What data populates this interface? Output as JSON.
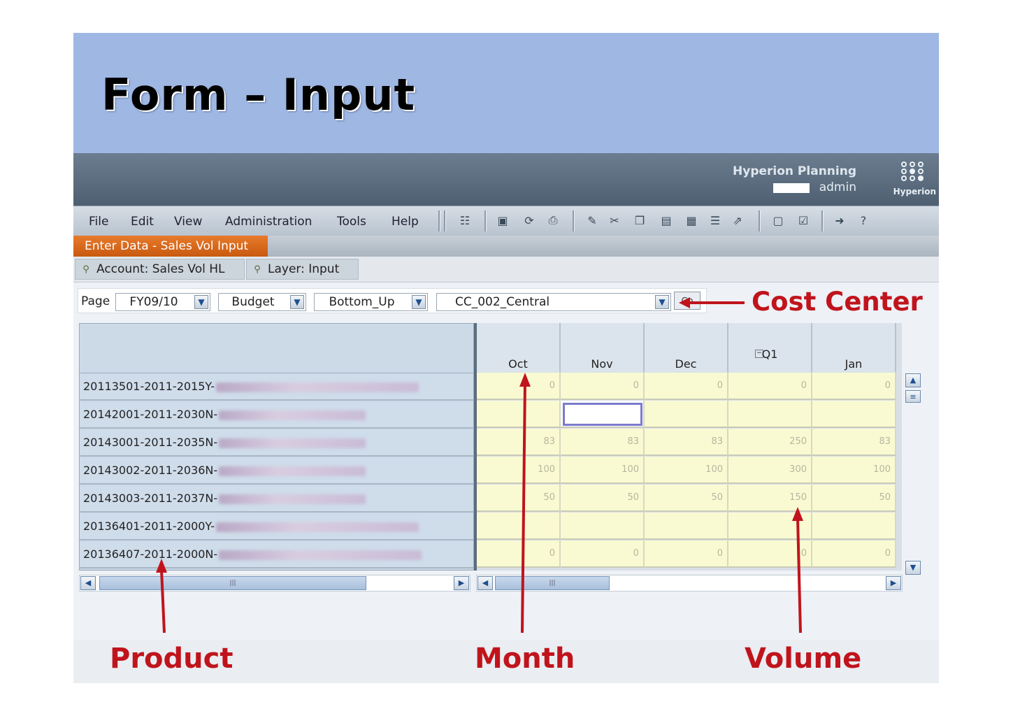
{
  "slide": {
    "title": "Form – Input"
  },
  "app": {
    "name": "Hyperion Planning",
    "user": "admin",
    "logo_text": "Hyperion"
  },
  "menu": [
    "File",
    "Edit",
    "View",
    "Administration",
    "Tools",
    "Help"
  ],
  "tab": {
    "label": "Enter Data - Sales Vol Input"
  },
  "pov": {
    "account": "Account: Sales Vol HL",
    "layer": "Layer: Input"
  },
  "page": {
    "label": "Page",
    "selectors": [
      "FY09/10",
      "Budget",
      "Bottom_Up",
      "CC_002_Central"
    ],
    "go_label": "Go"
  },
  "grid": {
    "columns": [
      "Oct",
      "Nov",
      "Dec",
      "Q1",
      "Jan"
    ],
    "rows": [
      {
        "product": "20113501-2011-2015Y-",
        "values": [
          "0",
          "0",
          "0",
          "0",
          "0"
        ]
      },
      {
        "product": "20142001-2011-2030N-",
        "values": [
          "",
          "",
          "",
          "",
          ""
        ]
      },
      {
        "product": "20143001-2011-2035N-",
        "values": [
          "83",
          "83",
          "83",
          "250",
          "83"
        ]
      },
      {
        "product": "20143002-2011-2036N-",
        "values": [
          "100",
          "100",
          "100",
          "300",
          "100"
        ]
      },
      {
        "product": "20143003-2011-2037N-",
        "values": [
          "50",
          "50",
          "50",
          "150",
          "50"
        ]
      },
      {
        "product": "20136401-2011-2000Y-",
        "values": [
          "",
          "",
          "",
          "",
          ""
        ]
      },
      {
        "product": "20136407-2011-2000N-",
        "values": [
          "0",
          "0",
          "0",
          "0",
          "0"
        ]
      }
    ]
  },
  "callouts": {
    "cost_center": "Cost Center",
    "product": "Product",
    "month": "Month",
    "volume": "Volume"
  },
  "colors": {
    "title_band": "#9fb7e3",
    "tab_active": "#e06a1e",
    "callout": "#c0141c",
    "cell": "#fafad2"
  }
}
